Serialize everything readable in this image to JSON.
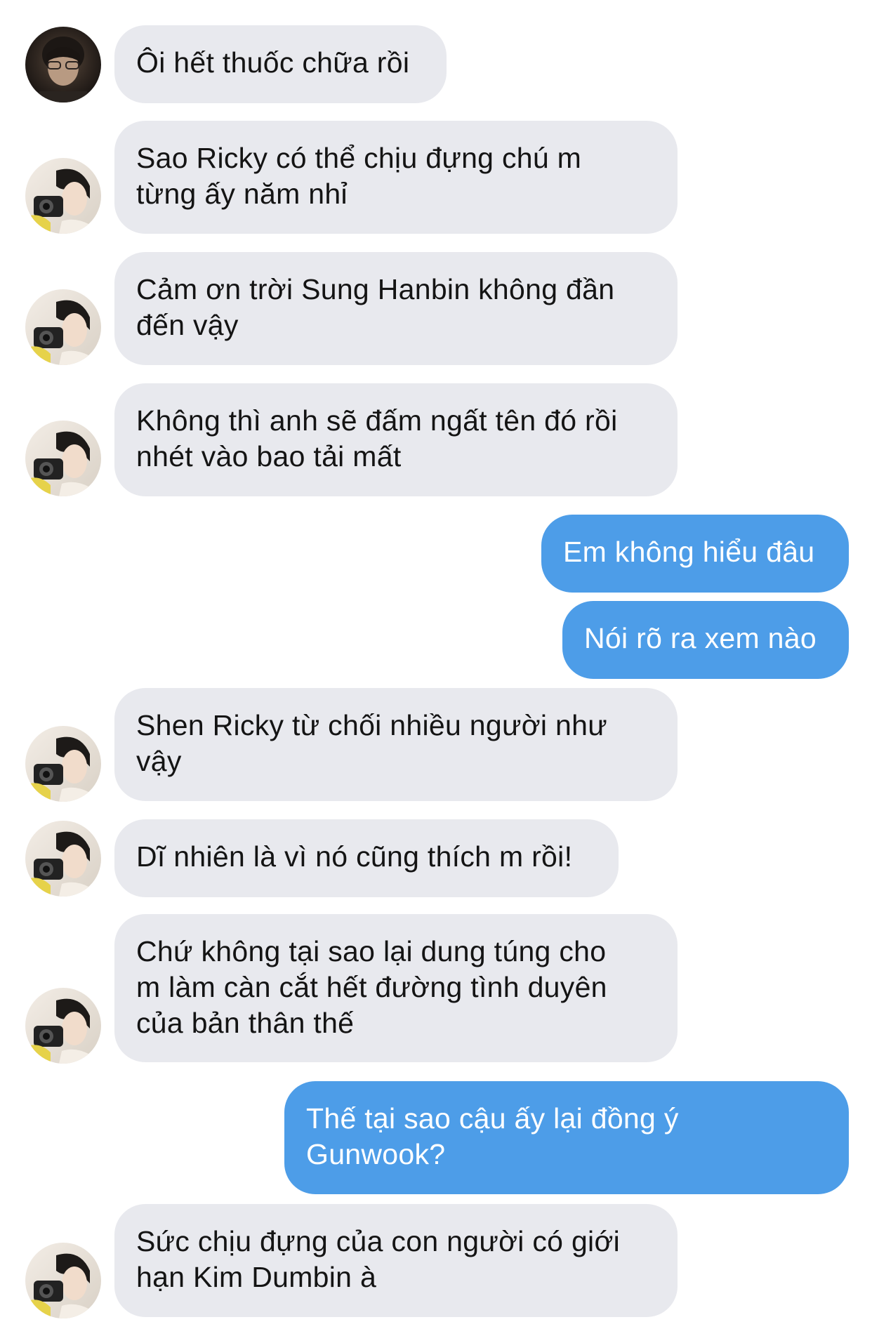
{
  "conversation": {
    "messages": [
      {
        "sender": "other",
        "avatar": "avatar-a",
        "lines": [
          "Ôi hết thuốc chữa rồi"
        ]
      },
      {
        "sender": "other",
        "avatar": "avatar-b",
        "lines": [
          "Sao Ricky có thể chịu đựng chú m",
          "từng ấy năm nhỉ"
        ]
      },
      {
        "sender": "other",
        "avatar": "avatar-b",
        "lines": [
          "Cảm ơn trời Sung Hanbin không đần",
          "đến vậy"
        ]
      },
      {
        "sender": "other",
        "avatar": "avatar-b",
        "lines": [
          "Không thì anh sẽ đấm ngất tên đó rồi",
          "nhét vào bao tải mất"
        ]
      },
      {
        "sender": "me",
        "lines": [
          "Em không hiểu đâu"
        ]
      },
      {
        "sender": "me",
        "lines": [
          "Nói rõ ra xem nào"
        ]
      },
      {
        "sender": "other",
        "avatar": "avatar-b",
        "lines": [
          "Shen Ricky từ chối nhiều người như",
          "vậy"
        ]
      },
      {
        "sender": "other",
        "avatar": "avatar-b",
        "lines": [
          "Dĩ nhiên là vì nó cũng thích m rồi!"
        ]
      },
      {
        "sender": "other",
        "avatar": "avatar-b",
        "lines": [
          "Chứ không tại sao lại dung túng cho",
          "m làm càn cắt hết đường tình duyên",
          "của bản thân thế"
        ]
      },
      {
        "sender": "me",
        "lines": [
          "Thế tại sao cậu ấy lại đồng ý",
          "Gunwook?"
        ]
      },
      {
        "sender": "other",
        "avatar": "avatar-b",
        "lines": [
          "Sức chịu đựng của con người có giới",
          "hạn Kim Dumbin à"
        ]
      }
    ]
  },
  "colors": {
    "incoming_bubble": "#e8e9ee",
    "outgoing_bubble": "#4d9de8",
    "incoming_text": "#141414",
    "outgoing_text": "#ffffff"
  }
}
